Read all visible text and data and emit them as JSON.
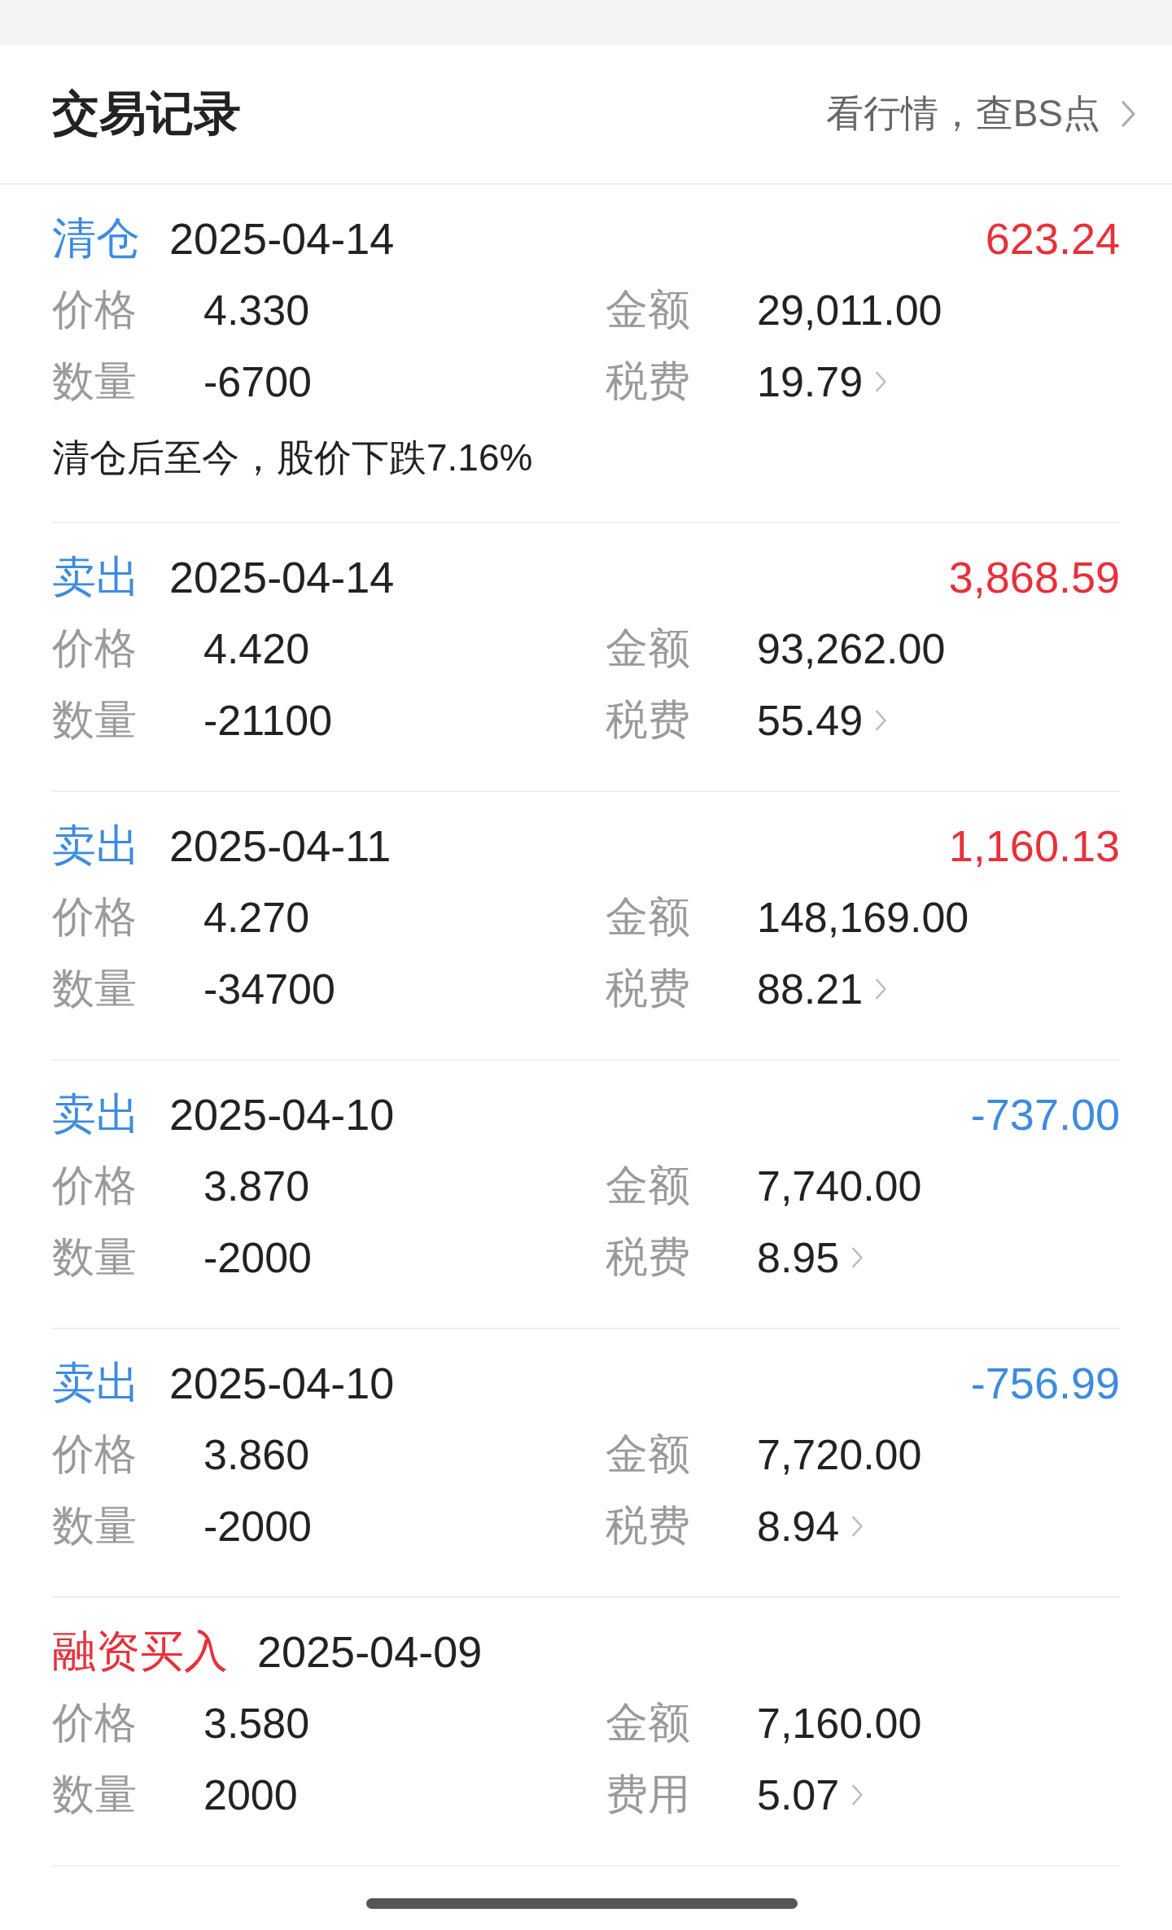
{
  "header": {
    "title": "交易记录",
    "link": "看行情，查BS点"
  },
  "records": [
    {
      "action": {
        "text": "清仓",
        "color": "#3d8be0"
      },
      "date": "2025-04-14",
      "profit": {
        "text": "623.24",
        "color": "#e8303a"
      },
      "fields": [
        {
          "label": "价格",
          "value": "4.330",
          "expandable": false
        },
        {
          "label": "金额",
          "value": "29,011.00",
          "expandable": false
        },
        {
          "label": "数量",
          "value": "-6700",
          "expandable": false
        },
        {
          "label": "税费",
          "value": "19.79",
          "expandable": true
        }
      ],
      "note": "清仓后至今，股价下跌7.16%"
    },
    {
      "action": {
        "text": "卖出",
        "color": "#3d8be0"
      },
      "date": "2025-04-14",
      "profit": {
        "text": "3,868.59",
        "color": "#e8303a"
      },
      "fields": [
        {
          "label": "价格",
          "value": "4.420",
          "expandable": false
        },
        {
          "label": "金额",
          "value": "93,262.00",
          "expandable": false
        },
        {
          "label": "数量",
          "value": "-21100",
          "expandable": false
        },
        {
          "label": "税费",
          "value": "55.49",
          "expandable": true
        }
      ]
    },
    {
      "action": {
        "text": "卖出",
        "color": "#3d8be0"
      },
      "date": "2025-04-11",
      "profit": {
        "text": "1,160.13",
        "color": "#e8303a"
      },
      "fields": [
        {
          "label": "价格",
          "value": "4.270",
          "expandable": false
        },
        {
          "label": "金额",
          "value": "148,169.00",
          "expandable": false
        },
        {
          "label": "数量",
          "value": "-34700",
          "expandable": false
        },
        {
          "label": "税费",
          "value": "88.21",
          "expandable": true
        }
      ]
    },
    {
      "action": {
        "text": "卖出",
        "color": "#3d8be0"
      },
      "date": "2025-04-10",
      "profit": {
        "text": "-737.00",
        "color": "#3d8be0"
      },
      "fields": [
        {
          "label": "价格",
          "value": "3.870",
          "expandable": false
        },
        {
          "label": "金额",
          "value": "7,740.00",
          "expandable": false
        },
        {
          "label": "数量",
          "value": "-2000",
          "expandable": false
        },
        {
          "label": "税费",
          "value": "8.95",
          "expandable": true
        }
      ]
    },
    {
      "action": {
        "text": "卖出",
        "color": "#3d8be0"
      },
      "date": "2025-04-10",
      "profit": {
        "text": "-756.99",
        "color": "#3d8be0"
      },
      "fields": [
        {
          "label": "价格",
          "value": "3.860",
          "expandable": false
        },
        {
          "label": "金额",
          "value": "7,720.00",
          "expandable": false
        },
        {
          "label": "数量",
          "value": "-2000",
          "expandable": false
        },
        {
          "label": "税费",
          "value": "8.94",
          "expandable": true
        }
      ]
    },
    {
      "action": {
        "text": "融资买入",
        "color": "#e8303a"
      },
      "date": "2025-04-09",
      "fields": [
        {
          "label": "价格",
          "value": "3.580",
          "expandable": false
        },
        {
          "label": "金额",
          "value": "7,160.00",
          "expandable": false
        },
        {
          "label": "数量",
          "value": "2000",
          "expandable": false
        },
        {
          "label": "费用",
          "value": "5.07",
          "expandable": true
        }
      ]
    }
  ]
}
